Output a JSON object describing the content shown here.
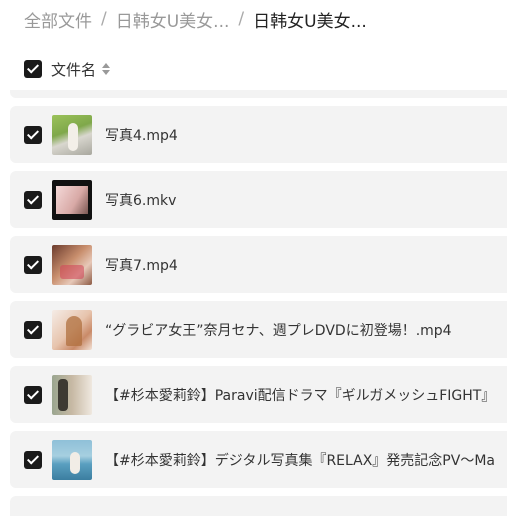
{
  "breadcrumb": {
    "items": [
      "全部文件",
      "日韩女U美女...",
      "日韩女U美女..."
    ],
    "separator": "/"
  },
  "list_header": {
    "name_column": "文件名",
    "all_selected": true
  },
  "files": [
    {
      "name": "写真4.mp4",
      "selected": true,
      "thumb_icon": "video-thumbnail"
    },
    {
      "name": "写真6.mkv",
      "selected": true,
      "thumb_icon": "video-thumbnail"
    },
    {
      "name": "写真7.mp4",
      "selected": true,
      "thumb_icon": "video-thumbnail"
    },
    {
      "name": "“グラビア女王”奈月セナ、週プレDVDに初登場！.mp4",
      "selected": true,
      "thumb_icon": "video-thumbnail"
    },
    {
      "name": "【#杉本愛莉鈴】Paravi配信ドラマ『ギルガメッシュFIGHT』",
      "selected": true,
      "thumb_icon": "video-thumbnail"
    },
    {
      "name": "【#杉本愛莉鈴】デジタル写真集『RELAX』発売記念PV〜Ma",
      "selected": true,
      "thumb_icon": "video-thumbnail"
    }
  ]
}
